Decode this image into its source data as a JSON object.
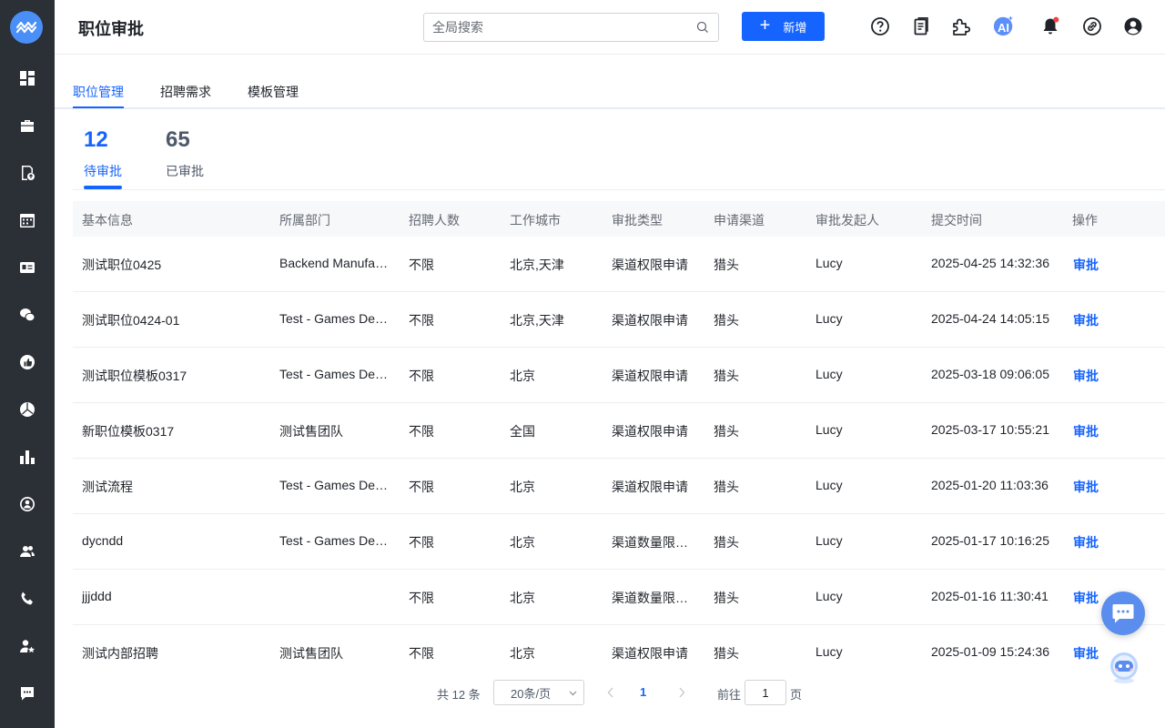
{
  "header": {
    "title": "职位审批",
    "search_placeholder": "全局搜索",
    "new_button": "新增",
    "ai_label": "AI"
  },
  "tabs": [
    {
      "label": "职位管理",
      "active": true
    },
    {
      "label": "招聘需求",
      "active": false
    },
    {
      "label": "模板管理",
      "active": false
    }
  ],
  "stats": {
    "pending": {
      "count": "12",
      "label": "待审批"
    },
    "approved": {
      "count": "65",
      "label": "已审批"
    }
  },
  "table": {
    "columns": [
      "基本信息",
      "所属部门",
      "招聘人数",
      "工作城市",
      "审批类型",
      "申请渠道",
      "审批发起人",
      "提交时间",
      "操作"
    ],
    "rows": [
      {
        "name": "测试职位0425",
        "dept": "Backend Manufa…",
        "count": "不限",
        "city": "北京,天津",
        "type": "渠道权限申请",
        "channel": "猎头",
        "initiator": "Lucy",
        "time": "2025-04-25 14:32:36",
        "action": "审批"
      },
      {
        "name": "测试职位0424-01",
        "dept": "Test - Games De…",
        "count": "不限",
        "city": "北京,天津",
        "type": "渠道权限申请",
        "channel": "猎头",
        "initiator": "Lucy",
        "time": "2025-04-24 14:05:15",
        "action": "审批"
      },
      {
        "name": "测试职位模板0317",
        "dept": "Test - Games De…",
        "count": "不限",
        "city": "北京",
        "type": "渠道权限申请",
        "channel": "猎头",
        "initiator": "Lucy",
        "time": "2025-03-18 09:06:05",
        "action": "审批"
      },
      {
        "name": "新职位模板0317",
        "dept": "测试售团队",
        "count": "不限",
        "city": "全国",
        "type": "渠道权限申请",
        "channel": "猎头",
        "initiator": "Lucy",
        "time": "2025-03-17 10:55:21",
        "action": "审批"
      },
      {
        "name": "测试流程",
        "dept": "Test - Games De…",
        "count": "不限",
        "city": "北京",
        "type": "渠道权限申请",
        "channel": "猎头",
        "initiator": "Lucy",
        "time": "2025-01-20 11:03:36",
        "action": "审批"
      },
      {
        "name": "dycndd",
        "dept": "Test - Games De…",
        "count": "不限",
        "city": "北京",
        "type": "渠道数量限…",
        "channel": "猎头",
        "initiator": "Lucy",
        "time": "2025-01-17 10:16:25",
        "action": "审批"
      },
      {
        "name": "jjjddd",
        "dept": "",
        "count": "不限",
        "city": "北京",
        "type": "渠道数量限…",
        "channel": "猎头",
        "initiator": "Lucy",
        "time": "2025-01-16 11:30:41",
        "action": "审批"
      },
      {
        "name": "测试内部招聘",
        "dept": "测试售团队",
        "count": "不限",
        "city": "北京",
        "type": "渠道权限申请",
        "channel": "猎头",
        "initiator": "Lucy",
        "time": "2025-01-09 15:24:36",
        "action": "审批"
      }
    ]
  },
  "pagination": {
    "total_text": "共 12 条",
    "page_size": "20条/页",
    "current_page": "1",
    "goto_label": "前往",
    "goto_value": "1",
    "page_suffix": "页"
  },
  "sidebar_icons": [
    "dashboard-icon",
    "briefcase-icon",
    "document-upload-icon",
    "calendar-icon",
    "id-card-icon",
    "wechat-icon",
    "thumbs-up-icon",
    "pie-chart-icon",
    "bar-chart-icon",
    "person-circle-icon",
    "users-icon",
    "phone-icon",
    "user-star-icon",
    "message-icon"
  ],
  "colors": {
    "accent": "#1664ff",
    "sidebar_bg": "#2b2f36",
    "header_bg": "#f7f8fa"
  }
}
